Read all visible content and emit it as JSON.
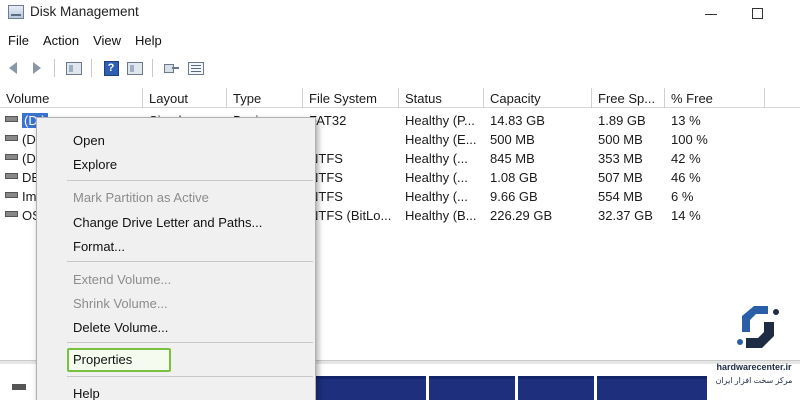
{
  "window": {
    "title": "Disk Management"
  },
  "menubar": [
    "File",
    "Action",
    "View",
    "Help"
  ],
  "toolbar": {
    "icons": [
      "back-arrow-icon",
      "forward-arrow-icon",
      "console-tree-icon",
      "help-icon",
      "panel-view-icon",
      "key-icon",
      "list-view-icon"
    ],
    "help_glyph": "?"
  },
  "columns": [
    "Volume",
    "Layout",
    "Type",
    "File System",
    "Status",
    "Capacity",
    "Free Sp...",
    "% Free"
  ],
  "rows": [
    {
      "volume": "(D:)",
      "layout": "Simple",
      "type": "Basic",
      "fs": "FAT32",
      "status": "Healthy (P...",
      "capacity": "14.83 GB",
      "free": "1.89 GB",
      "pct": "13 %"
    },
    {
      "volume": "(D",
      "layout": "",
      "type": "",
      "fs": "",
      "status": "Healthy (E...",
      "capacity": "500 MB",
      "free": "500 MB",
      "pct": "100 %"
    },
    {
      "volume": "(D",
      "layout": "",
      "type": "",
      "fs": "NTFS",
      "status": "Healthy (...",
      "capacity": "845 MB",
      "free": "353 MB",
      "pct": "42 %"
    },
    {
      "volume": "DE",
      "layout": "",
      "type": "",
      "fs": "NTFS",
      "status": "Healthy (...",
      "capacity": "1.08 GB",
      "free": "507 MB",
      "pct": "46 %"
    },
    {
      "volume": "Im",
      "layout": "",
      "type": "",
      "fs": "NTFS",
      "status": "Healthy (...",
      "capacity": "9.66 GB",
      "free": "554 MB",
      "pct": "6 %"
    },
    {
      "volume": "OS",
      "layout": "",
      "type": "",
      "fs": "NTFS (BitLo...",
      "status": "Healthy (B...",
      "capacity": "226.29 GB",
      "free": "32.37 GB",
      "pct": "14 %"
    }
  ],
  "context_menu": {
    "items": [
      {
        "label": "Open",
        "enabled": true
      },
      {
        "label": "Explore",
        "enabled": true
      },
      {
        "label": "Mark Partition as Active",
        "enabled": false
      },
      {
        "label": "Change Drive Letter and Paths...",
        "enabled": true
      },
      {
        "label": "Format...",
        "enabled": true
      },
      {
        "label": "Extend Volume...",
        "enabled": false
      },
      {
        "label": "Shrink Volume...",
        "enabled": false
      },
      {
        "label": "Delete Volume...",
        "enabled": true
      },
      {
        "label": "Properties",
        "enabled": true,
        "highlighted": true
      },
      {
        "label": "Help",
        "enabled": true
      }
    ]
  },
  "watermark": {
    "site": "hardwarecenter.ir",
    "tagline": "مرکز سخت افزار ایران"
  },
  "colors": {
    "selection": "#3b73d1",
    "disk_bar": "#1d2f7d",
    "highlight_border": "#7ac142",
    "logo": "#2a5fa8"
  }
}
